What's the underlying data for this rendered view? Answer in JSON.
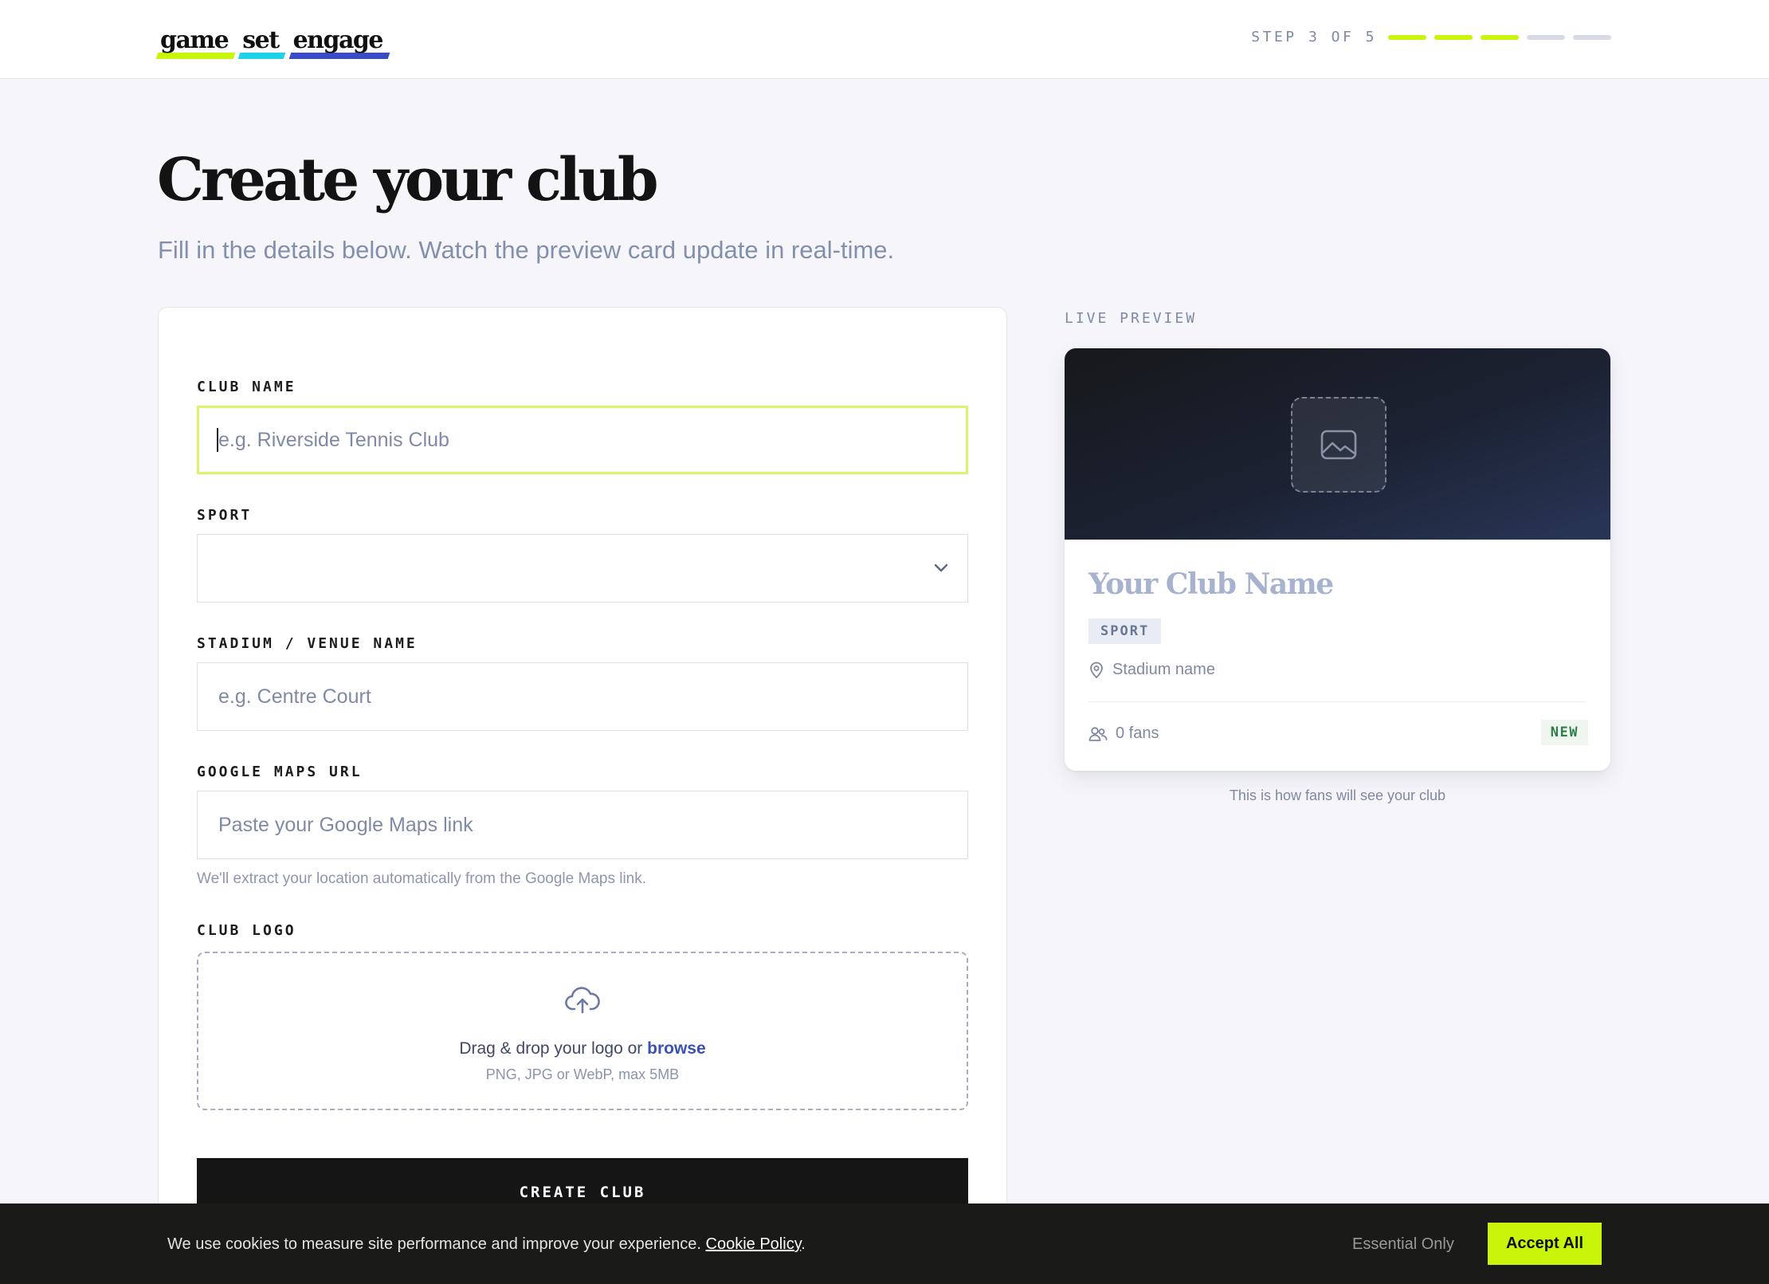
{
  "header": {
    "logo_words": [
      "game",
      "set",
      "engage"
    ],
    "logo_colors": [
      "#c8f50a",
      "#1fd1e6",
      "#3b4bc4"
    ],
    "step_label": "STEP 3 OF 5",
    "step_current": 3,
    "step_total": 5,
    "accent": "#c8f50a"
  },
  "page": {
    "title": "Create your club",
    "subtitle": "Fill in the details below. Watch the preview card update in real-time."
  },
  "form": {
    "club_name": {
      "label": "CLUB NAME",
      "placeholder": "e.g. Riverside Tennis Club",
      "value": ""
    },
    "sport": {
      "label": "SPORT",
      "value": ""
    },
    "venue": {
      "label": "STADIUM / VENUE NAME",
      "placeholder": "e.g. Centre Court",
      "value": ""
    },
    "maps": {
      "label": "GOOGLE MAPS URL",
      "placeholder": "Paste your Google Maps link",
      "value": "",
      "hint": "We'll extract your location automatically from the Google Maps link."
    },
    "logo": {
      "label": "CLUB LOGO",
      "drop_text": "Drag & drop your logo or",
      "browse": "browse",
      "formats": "PNG, JPG or WebP, max 5MB"
    },
    "submit_label": "CREATE CLUB"
  },
  "preview": {
    "label": "LIVE PREVIEW",
    "club_name": "Your Club Name",
    "sport": "SPORT",
    "stadium": "Stadium name",
    "fans": "0 fans",
    "badge": "NEW",
    "caption": "This is how fans will see your club"
  },
  "cookie": {
    "text": "We use cookies to measure site performance and improve your experience.",
    "policy_link": "Cookie Policy",
    "essential_label": "Essential Only",
    "accept_label": "Accept All"
  }
}
